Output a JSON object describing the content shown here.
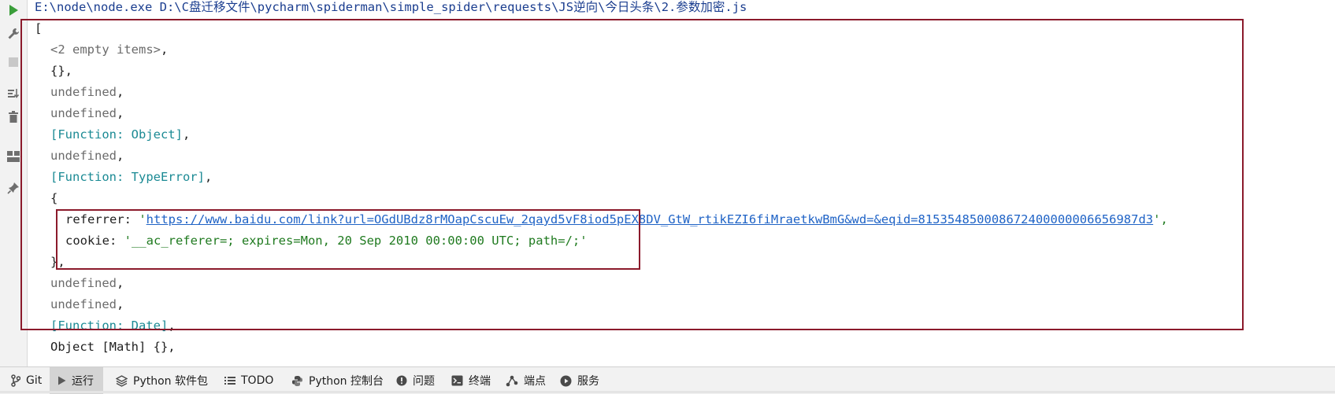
{
  "run": {
    "command": "E:\\node\\node.exe D:\\C盘迁移文件\\pycharm\\spiderman\\simple_spider\\requests\\JS逆向\\今日头条\\2.参数加密.js"
  },
  "output": {
    "open_bracket": "[",
    "empty_items": "<2 empty items>",
    "empty_obj": "{}",
    "comma": ",",
    "undefined": "undefined",
    "fn_object": "[Function: Object]",
    "fn_typeerror": "[Function: TypeError]",
    "open_brace": "{",
    "referrer_key": "referrer: ",
    "quote": "'",
    "referrer_url": "https://www.baidu.com/link?url=OGdUBdz8rMOapCscuEw_2qayd5vF8iod5pEX8DV_GtW_rtikEZI6fiMraetkwBmG&wd=&eqid=815354850008672400000006656987d3",
    "referrer_tail": "',",
    "cookie_key": "cookie: ",
    "cookie_value": "'__ac_referer=; expires=Mon, 20 Sep 2010 00:00:00 UTC; path=/;'",
    "close_brace": "},",
    "fn_date": "[Function: Date]",
    "math_obj": "Object [Math] {},"
  },
  "bottom_tabs": [
    {
      "label": "Git",
      "icon": "git-branch-icon"
    },
    {
      "label": "运行",
      "icon": "play-icon"
    },
    {
      "label": "Python 软件包",
      "icon": "layers-icon"
    },
    {
      "label": "TODO",
      "icon": "list-icon"
    },
    {
      "label": "Python 控制台",
      "icon": "python-icon"
    },
    {
      "label": "问题",
      "icon": "warning-icon"
    },
    {
      "label": "终端",
      "icon": "terminal-icon"
    },
    {
      "label": "端点",
      "icon": "endpoints-icon"
    },
    {
      "label": "服务",
      "icon": "services-icon"
    }
  ],
  "colors": {
    "highlight_box": "#8b1a2b",
    "function_teal": "#1b8a94",
    "string_green": "#1f7a1f",
    "link_blue": "#1f63c6",
    "command_blue": "#1a3d8f"
  }
}
